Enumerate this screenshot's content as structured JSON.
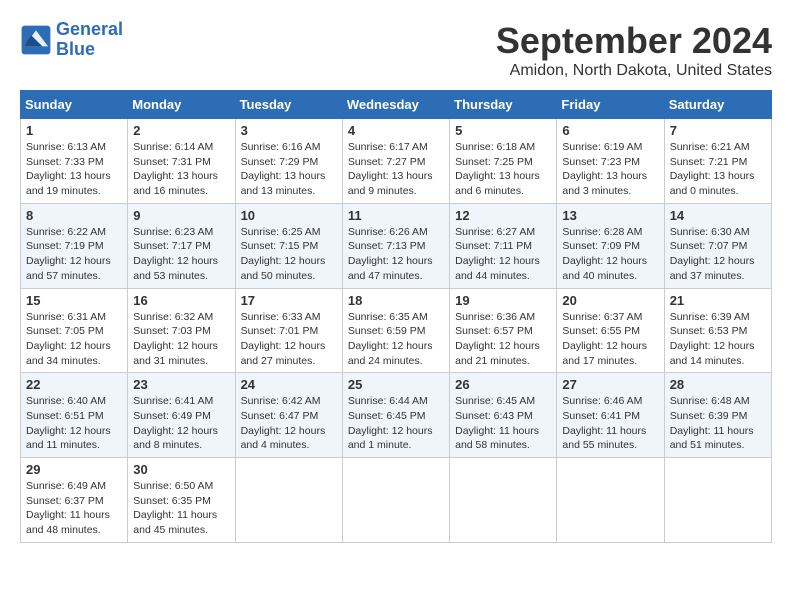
{
  "header": {
    "logo_line1": "General",
    "logo_line2": "Blue",
    "month_year": "September 2024",
    "location": "Amidon, North Dakota, United States"
  },
  "days_of_week": [
    "Sunday",
    "Monday",
    "Tuesday",
    "Wednesday",
    "Thursday",
    "Friday",
    "Saturday"
  ],
  "weeks": [
    [
      {
        "day": "1",
        "info": "Sunrise: 6:13 AM\nSunset: 7:33 PM\nDaylight: 13 hours and 19 minutes."
      },
      {
        "day": "2",
        "info": "Sunrise: 6:14 AM\nSunset: 7:31 PM\nDaylight: 13 hours and 16 minutes."
      },
      {
        "day": "3",
        "info": "Sunrise: 6:16 AM\nSunset: 7:29 PM\nDaylight: 13 hours and 13 minutes."
      },
      {
        "day": "4",
        "info": "Sunrise: 6:17 AM\nSunset: 7:27 PM\nDaylight: 13 hours and 9 minutes."
      },
      {
        "day": "5",
        "info": "Sunrise: 6:18 AM\nSunset: 7:25 PM\nDaylight: 13 hours and 6 minutes."
      },
      {
        "day": "6",
        "info": "Sunrise: 6:19 AM\nSunset: 7:23 PM\nDaylight: 13 hours and 3 minutes."
      },
      {
        "day": "7",
        "info": "Sunrise: 6:21 AM\nSunset: 7:21 PM\nDaylight: 13 hours and 0 minutes."
      }
    ],
    [
      {
        "day": "8",
        "info": "Sunrise: 6:22 AM\nSunset: 7:19 PM\nDaylight: 12 hours and 57 minutes."
      },
      {
        "day": "9",
        "info": "Sunrise: 6:23 AM\nSunset: 7:17 PM\nDaylight: 12 hours and 53 minutes."
      },
      {
        "day": "10",
        "info": "Sunrise: 6:25 AM\nSunset: 7:15 PM\nDaylight: 12 hours and 50 minutes."
      },
      {
        "day": "11",
        "info": "Sunrise: 6:26 AM\nSunset: 7:13 PM\nDaylight: 12 hours and 47 minutes."
      },
      {
        "day": "12",
        "info": "Sunrise: 6:27 AM\nSunset: 7:11 PM\nDaylight: 12 hours and 44 minutes."
      },
      {
        "day": "13",
        "info": "Sunrise: 6:28 AM\nSunset: 7:09 PM\nDaylight: 12 hours and 40 minutes."
      },
      {
        "day": "14",
        "info": "Sunrise: 6:30 AM\nSunset: 7:07 PM\nDaylight: 12 hours and 37 minutes."
      }
    ],
    [
      {
        "day": "15",
        "info": "Sunrise: 6:31 AM\nSunset: 7:05 PM\nDaylight: 12 hours and 34 minutes."
      },
      {
        "day": "16",
        "info": "Sunrise: 6:32 AM\nSunset: 7:03 PM\nDaylight: 12 hours and 31 minutes."
      },
      {
        "day": "17",
        "info": "Sunrise: 6:33 AM\nSunset: 7:01 PM\nDaylight: 12 hours and 27 minutes."
      },
      {
        "day": "18",
        "info": "Sunrise: 6:35 AM\nSunset: 6:59 PM\nDaylight: 12 hours and 24 minutes."
      },
      {
        "day": "19",
        "info": "Sunrise: 6:36 AM\nSunset: 6:57 PM\nDaylight: 12 hours and 21 minutes."
      },
      {
        "day": "20",
        "info": "Sunrise: 6:37 AM\nSunset: 6:55 PM\nDaylight: 12 hours and 17 minutes."
      },
      {
        "day": "21",
        "info": "Sunrise: 6:39 AM\nSunset: 6:53 PM\nDaylight: 12 hours and 14 minutes."
      }
    ],
    [
      {
        "day": "22",
        "info": "Sunrise: 6:40 AM\nSunset: 6:51 PM\nDaylight: 12 hours and 11 minutes."
      },
      {
        "day": "23",
        "info": "Sunrise: 6:41 AM\nSunset: 6:49 PM\nDaylight: 12 hours and 8 minutes."
      },
      {
        "day": "24",
        "info": "Sunrise: 6:42 AM\nSunset: 6:47 PM\nDaylight: 12 hours and 4 minutes."
      },
      {
        "day": "25",
        "info": "Sunrise: 6:44 AM\nSunset: 6:45 PM\nDaylight: 12 hours and 1 minute."
      },
      {
        "day": "26",
        "info": "Sunrise: 6:45 AM\nSunset: 6:43 PM\nDaylight: 11 hours and 58 minutes."
      },
      {
        "day": "27",
        "info": "Sunrise: 6:46 AM\nSunset: 6:41 PM\nDaylight: 11 hours and 55 minutes."
      },
      {
        "day": "28",
        "info": "Sunrise: 6:48 AM\nSunset: 6:39 PM\nDaylight: 11 hours and 51 minutes."
      }
    ],
    [
      {
        "day": "29",
        "info": "Sunrise: 6:49 AM\nSunset: 6:37 PM\nDaylight: 11 hours and 48 minutes."
      },
      {
        "day": "30",
        "info": "Sunrise: 6:50 AM\nSunset: 6:35 PM\nDaylight: 11 hours and 45 minutes."
      },
      null,
      null,
      null,
      null,
      null
    ]
  ]
}
